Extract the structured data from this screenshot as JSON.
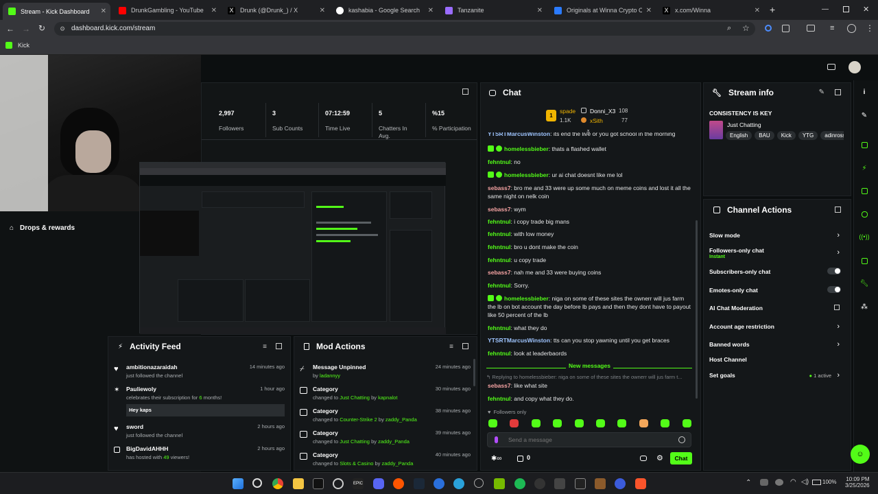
{
  "browser": {
    "tabs": [
      {
        "title": "Stream - Kick Dashboard",
        "color": "#53fc18",
        "active": true
      },
      {
        "title": "DrunkGambling - YouTube",
        "color": "#ff0000"
      },
      {
        "title": "Drunk (@Drunk_) / X",
        "color": "#ffffff"
      },
      {
        "title": "kashabia - Google Search",
        "color": "#4285f4"
      },
      {
        "title": "Tanzanite",
        "color": "#9a6cff"
      },
      {
        "title": "Originals at Winna Crypto Casino",
        "color": "#2b7bff"
      },
      {
        "title": "x.com/Winna",
        "color": "#ffffff"
      }
    ],
    "url": "dashboard.kick.com/stream",
    "bookmark": "Kick"
  },
  "sidebar": {
    "drops_label": "Drops & rewards"
  },
  "stats": [
    {
      "value": "2,997",
      "label": "Followers"
    },
    {
      "value": "3",
      "label": "Sub Counts"
    },
    {
      "value": "07:12:59",
      "label": "Time Live"
    },
    {
      "value": "5",
      "label": "Chatters In Avg."
    },
    {
      "value": "%15",
      "label": "% Participation"
    }
  ],
  "chat": {
    "title": "Chat",
    "leaderboard": {
      "rank": "1",
      "first": "spade",
      "first_count": "1.1K",
      "second": "Donni_X3",
      "second_count": "108",
      "third": "xSith",
      "third_count": "77"
    },
    "messages": [
      {
        "user": "YTSRTMarcusWinston",
        "text": "its end the live or you got school in the morning",
        "color": "#9fc5ff",
        "badges": 0
      },
      {
        "user": "homelessbieber",
        "text": "thats a flashed wallet",
        "color": "#53fc18",
        "badges": 2
      },
      {
        "user": "fehntnul",
        "text": "no",
        "color": "#53fc18",
        "badges": 0
      },
      {
        "user": "homelessbieber",
        "text": "ur ai chat doesnt like me lol",
        "color": "#53fc18",
        "badges": 2
      },
      {
        "user": "sebass7",
        "text": "bro me and 33 were up some much on meme coins and lost it all the same night on nelk coin",
        "color": "#f7a4a4",
        "badges": 0
      },
      {
        "user": "sebass7",
        "text": "wym",
        "color": "#f7a4a4",
        "badges": 0
      },
      {
        "user": "fehntnul",
        "text": "i copy trade big mans",
        "color": "#53fc18",
        "badges": 0
      },
      {
        "user": "fehntnul",
        "text": "with low money",
        "color": "#53fc18",
        "badges": 0
      },
      {
        "user": "fehntnul",
        "text": "bro u dont make the coin",
        "color": "#53fc18",
        "badges": 0
      },
      {
        "user": "fehntnul",
        "text": "u copy trade",
        "color": "#53fc18",
        "badges": 0
      },
      {
        "user": "sebass7",
        "text": "nah me and 33 were buying coins",
        "color": "#f7a4a4",
        "badges": 0
      },
      {
        "user": "fehntnul",
        "text": "Sorry.",
        "color": "#53fc18",
        "badges": 0
      },
      {
        "user": "homelessbieber",
        "text": "niga on some of these sites the ownerr will jus farm the lb on bot account the day before lb pays and then they dont have to payout like 50 percent of the lb",
        "color": "#53fc18",
        "badges": 2
      },
      {
        "user": "fehntnul",
        "text": "what they do",
        "color": "#53fc18",
        "badges": 0
      },
      {
        "user": "YTSRTMarcusWinston",
        "text": "tts can you stop yawning until you get braces",
        "color": "#9fc5ff",
        "badges": 0
      },
      {
        "user": "fehntnul",
        "text": "look at leaderbaords",
        "color": "#53fc18",
        "badges": 0
      }
    ],
    "new_messages_label": "New messages",
    "reply_preview": "Replying to homelessbieber: niga on some of these sites the ownerr will jus farm t...",
    "after_new": [
      {
        "user": "sebass7",
        "text": "like what site",
        "color": "#f7a4a4"
      },
      {
        "user": "fehntnul",
        "text": "and copy what they do.",
        "color": "#53fc18"
      }
    ],
    "followers_only_label": "Followers only",
    "input_placeholder": "Send a message",
    "points": "0",
    "send_label": "Chat"
  },
  "stream_info": {
    "title": "Stream info",
    "stream_title": "CONSISTENCY IS KEY",
    "category": "Just Chatting",
    "tags": [
      "English",
      "BAU",
      "Kick",
      "YTG",
      "adinross"
    ]
  },
  "channel_actions": {
    "title": "Channel Actions",
    "items": [
      {
        "label": "Slow mode",
        "control": "chevron"
      },
      {
        "label": "Followers-only chat",
        "sub": "Instant",
        "control": "chevron"
      },
      {
        "label": "Subscribers-only chat",
        "control": "toggle"
      },
      {
        "label": "Emotes-only chat",
        "control": "toggle"
      },
      {
        "label": "AI Chat Moderation",
        "control": "external"
      },
      {
        "label": "Account age restriction",
        "control": "chevron"
      },
      {
        "label": "Banned words",
        "control": "chevron"
      },
      {
        "label": "Host Channel",
        "control": "none"
      },
      {
        "label": "Set goals",
        "status": "1 active",
        "control": "chevron"
      }
    ]
  },
  "activity_feed": {
    "title": "Activity Feed",
    "items": [
      {
        "name": "ambitionazaraidah",
        "desc": "just followed the channel",
        "time": "14 minutes ago"
      },
      {
        "name": "Pauliewoly",
        "desc_pre": "celebrates their subscription for ",
        "desc_num": "6",
        "desc_post": " months!",
        "message": "Hey kaps",
        "time": "1 hour ago"
      },
      {
        "name": "sword",
        "desc": "just followed the channel",
        "time": "2 hours ago"
      },
      {
        "name": "BigDavidAHHH",
        "desc_pre": "has hosted with ",
        "desc_num": "49",
        "desc_post": " viewers!",
        "time": "2 hours ago"
      }
    ]
  },
  "mod_actions": {
    "title": "Mod Actions",
    "items": [
      {
        "name": "Message Unpinned",
        "pre": "by ",
        "val": "ladannyy",
        "time": "24 minutes ago"
      },
      {
        "name": "Category",
        "pre": "changed to ",
        "val": "Just Chatting",
        "mid": " by ",
        "by": "kapnalot",
        "time": "30 minutes ago"
      },
      {
        "name": "Category",
        "pre": "changed to ",
        "val": "Counter-Strike 2",
        "mid": " by ",
        "by": "zaddy_Panda",
        "time": "38 minutes ago"
      },
      {
        "name": "Category",
        "pre": "changed to ",
        "val": "Just Chatting",
        "mid": " by ",
        "by": "zaddy_Panda",
        "time": "39 minutes ago"
      },
      {
        "name": "Category",
        "pre": "changed to ",
        "val": "Slots & Casino",
        "mid": " by ",
        "by": "zaddy_Panda",
        "time": "40 minutes ago"
      }
    ]
  },
  "taskbar": {
    "time": "10:09 PM",
    "date": "3/25/2026",
    "battery": "100%"
  }
}
